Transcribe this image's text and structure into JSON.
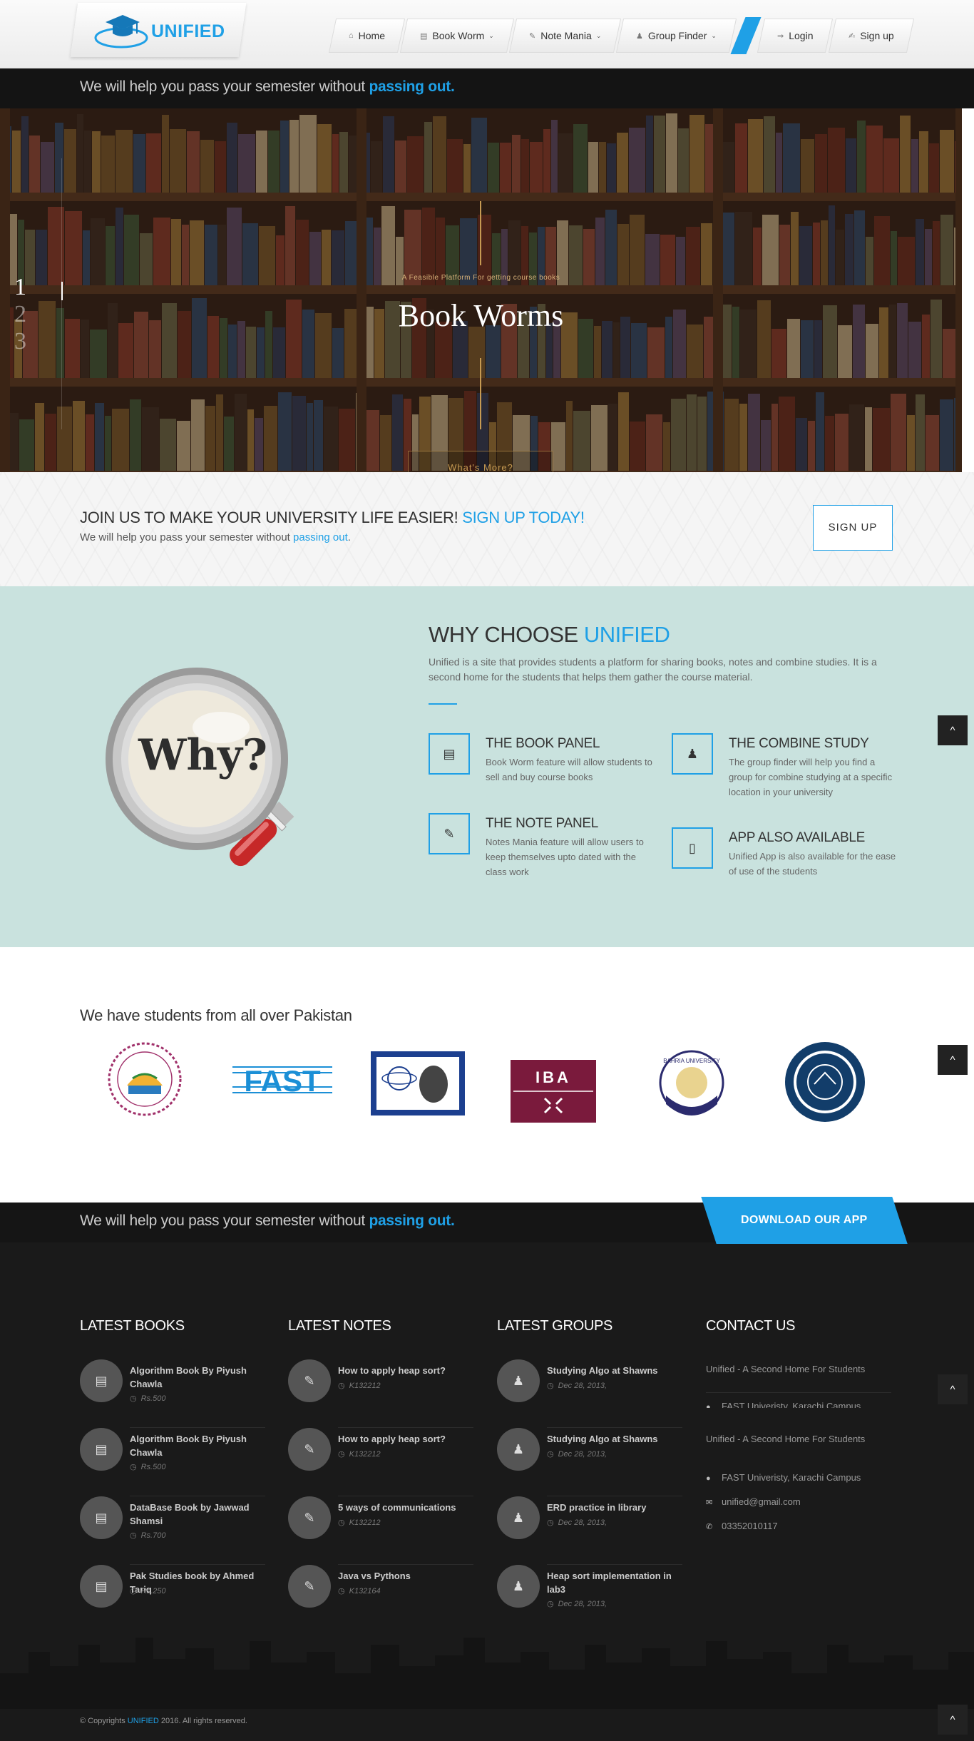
{
  "header": {
    "logo_text": "UNIFIED",
    "nav": [
      {
        "label": "Home",
        "icon": "home-icon",
        "glyph": "⌂",
        "caret": false
      },
      {
        "label": "Book Worm",
        "icon": "book-icon",
        "glyph": "▤",
        "caret": true
      },
      {
        "label": "Note Mania",
        "icon": "pencil-icon",
        "glyph": "✎",
        "caret": true
      },
      {
        "label": "Group Finder",
        "icon": "group-icon",
        "glyph": "♟",
        "caret": true
      },
      {
        "label": "Login",
        "icon": "login-icon",
        "glyph": "⇒",
        "caret": false
      },
      {
        "label": "Sign up",
        "icon": "signup-icon",
        "glyph": "✍",
        "caret": false
      }
    ]
  },
  "tagline": {
    "text": "We will help you pass your semester without ",
    "highlight": "passing out."
  },
  "hero": {
    "slides": [
      "1",
      "2",
      "3"
    ],
    "active_slide": 1,
    "subtitle": "A Feasible Platform For getting course books",
    "title": "Book Worms",
    "button": "What's More?"
  },
  "join": {
    "title": "JOIN US TO MAKE YOUR UNIVERSITY LIFE EASIER!",
    "title_highlight": "SIGN UP TODAY!",
    "sub": "We will help you pass your semester without ",
    "sub_highlight": "passing out",
    "sub_end": ".",
    "button": "SIGN UP"
  },
  "why": {
    "title": "WHY CHOOSE ",
    "title_highlight": "UNIFIED",
    "image_text": "Why?",
    "paragraph": "Unified is a site that provides students a platform for sharing books, notes and combine studies. It is a second home for the students that helps them gather the course material.",
    "features": [
      {
        "title": "THE BOOK PANEL",
        "desc": "Book Worm feature will allow students to sell and buy course books",
        "icon": "book-icon",
        "glyph": "▤"
      },
      {
        "title": "THE COMBINE STUDY",
        "desc": "The group finder will help you find a group for combine studying at a specific location in your university",
        "icon": "group-icon",
        "glyph": "♟"
      },
      {
        "title": "THE NOTE PANEL",
        "desc": "Notes Mania feature will allow users to keep themselves upto dated with the class work",
        "icon": "pencil-icon",
        "glyph": "✎"
      },
      {
        "title": "APP ALSO AVAILABLE",
        "desc": "Unified App is also available for the ease of use of the students",
        "icon": "mobile-icon",
        "glyph": "▯"
      }
    ]
  },
  "students": {
    "title": "We have students from all over Pakistan",
    "logos": [
      "ned-logo",
      "fast-logo",
      "szabist-logo",
      "iba-logo",
      "bahria-logo",
      "nust-logo"
    ],
    "fast_text": "FAST",
    "iba_text": "IBA",
    "bahria_text": "BAHRIA UNIVERSITY"
  },
  "footer": {
    "tagline": "We will help you pass your semester without ",
    "tagline_highlight": "passing out.",
    "download_button": "DOWNLOAD OUR APP",
    "books": {
      "title": "LATEST BOOKS",
      "items": [
        {
          "name": "Algorithm Book By Piyush Chawla",
          "meta": "Rs.500"
        },
        {
          "name": "Algorithm Book By Piyush Chawla",
          "meta": "Rs.500"
        },
        {
          "name": "DataBase Book by Jawwad Shamsi",
          "meta": "Rs.700"
        },
        {
          "name": "Pak Studies book by Ahmed Tariq",
          "meta": "Rs.250"
        }
      ]
    },
    "notes": {
      "title": "LATEST NOTES",
      "items": [
        {
          "name": "How to apply heap sort?",
          "meta": "K132212"
        },
        {
          "name": "How to apply heap sort?",
          "meta": "K132212"
        },
        {
          "name": "5 ways of communications",
          "meta": "K132212"
        },
        {
          "name": "Java vs Pythons",
          "meta": "K132164"
        }
      ]
    },
    "groups": {
      "title": "LATEST GROUPS",
      "items": [
        {
          "name": "Studying Algo at Shawns",
          "meta": "Dec 28, 2013,"
        },
        {
          "name": "Studying Algo at Shawns",
          "meta": "Dec 28, 2013,"
        },
        {
          "name": "ERD practice in library",
          "meta": "Dec 28, 2013,"
        },
        {
          "name": "Heap sort implementation in lab3",
          "meta": "Dec 28, 2013,"
        }
      ]
    },
    "contact": {
      "title": "CONTACT US",
      "tagline": "Unified - A Second Home For Students",
      "tagline2": "Unified - A Second Home For Students",
      "address_partial": "FAST Univeristy, Karachi Campus",
      "address": "FAST Univeristy, Karachi Campus",
      "email": "unified@gmail.com",
      "phone": "03352010117"
    },
    "copyright_pre": "© Copyrights ",
    "copyright_brand": "UNIFIED",
    "copyright_post": " 2016. All rights reserved."
  },
  "to_top": "^"
}
